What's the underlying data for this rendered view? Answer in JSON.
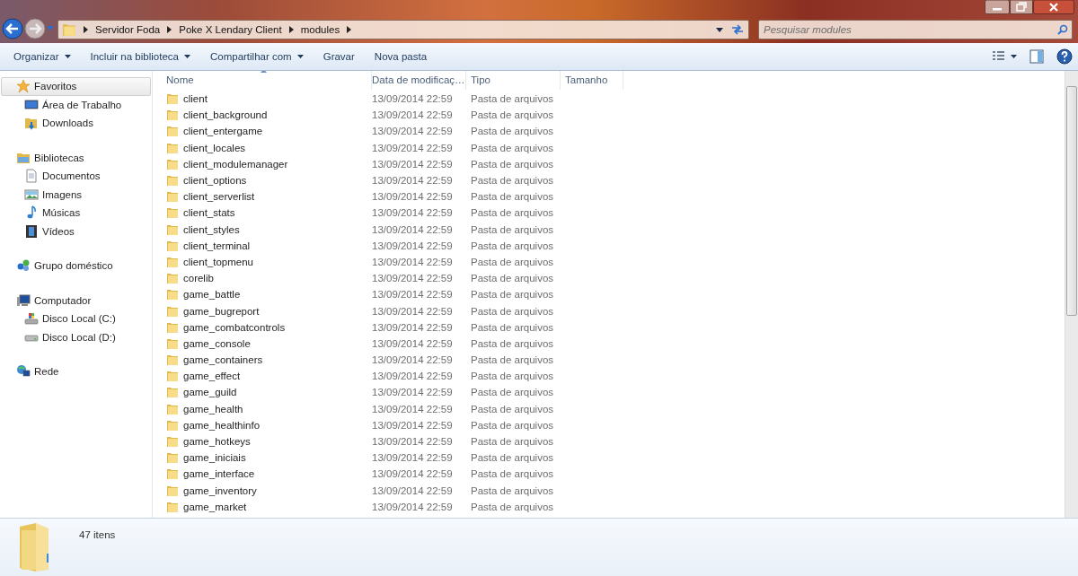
{
  "address_bar": {
    "breadcrumbs": [
      "Servidor Foda",
      "Poke X Lendary Client",
      "modules"
    ]
  },
  "search": {
    "placeholder": "Pesquisar modules"
  },
  "toolbar": {
    "buttons": [
      {
        "label": "Organizar",
        "dropdown": true
      },
      {
        "label": "Incluir na biblioteca",
        "dropdown": true
      },
      {
        "label": "Compartilhar com",
        "dropdown": true
      },
      {
        "label": "Gravar",
        "dropdown": false
      },
      {
        "label": "Nova pasta",
        "dropdown": false
      }
    ]
  },
  "sidebar": {
    "groups": [
      {
        "label": "Favoritos",
        "kind": "favorites",
        "selected": true,
        "children": [
          {
            "label": "Área de Trabalho",
            "kind": "desktop",
            "selected": false
          },
          {
            "label": "Downloads",
            "kind": "downloads",
            "selected": false
          }
        ]
      },
      {
        "label": "Bibliotecas",
        "kind": "libraries",
        "selected": false,
        "children": [
          {
            "label": "Documentos",
            "kind": "documents",
            "selected": false
          },
          {
            "label": "Imagens",
            "kind": "images",
            "selected": false
          },
          {
            "label": "Músicas",
            "kind": "music",
            "selected": false
          },
          {
            "label": "Vídeos",
            "kind": "videos",
            "selected": false
          }
        ]
      },
      {
        "label": "Grupo doméstico",
        "kind": "homegroup",
        "selected": false
      },
      {
        "label": "Computador",
        "kind": "computer",
        "selected": false,
        "children": [
          {
            "label": "Disco Local (C:)",
            "kind": "systemdrive",
            "selected": false
          },
          {
            "label": "Disco Local (D:)",
            "kind": "drive",
            "selected": false
          }
        ]
      },
      {
        "label": "Rede",
        "kind": "network",
        "selected": false
      }
    ]
  },
  "file_list": {
    "columns": [
      "Nome",
      "Data de modificaç…",
      "Tipo",
      "Tamanho"
    ],
    "rows": [
      {
        "name": "client",
        "modified": "13/09/2014 22:59",
        "type": "Pasta de arquivos"
      },
      {
        "name": "client_background",
        "modified": "13/09/2014 22:59",
        "type": "Pasta de arquivos"
      },
      {
        "name": "client_entergame",
        "modified": "13/09/2014 22:59",
        "type": "Pasta de arquivos"
      },
      {
        "name": "client_locales",
        "modified": "13/09/2014 22:59",
        "type": "Pasta de arquivos"
      },
      {
        "name": "client_modulemanager",
        "modified": "13/09/2014 22:59",
        "type": "Pasta de arquivos"
      },
      {
        "name": "client_options",
        "modified": "13/09/2014 22:59",
        "type": "Pasta de arquivos"
      },
      {
        "name": "client_serverlist",
        "modified": "13/09/2014 22:59",
        "type": "Pasta de arquivos"
      },
      {
        "name": "client_stats",
        "modified": "13/09/2014 22:59",
        "type": "Pasta de arquivos"
      },
      {
        "name": "client_styles",
        "modified": "13/09/2014 22:59",
        "type": "Pasta de arquivos"
      },
      {
        "name": "client_terminal",
        "modified": "13/09/2014 22:59",
        "type": "Pasta de arquivos"
      },
      {
        "name": "client_topmenu",
        "modified": "13/09/2014 22:59",
        "type": "Pasta de arquivos"
      },
      {
        "name": "corelib",
        "modified": "13/09/2014 22:59",
        "type": "Pasta de arquivos"
      },
      {
        "name": "game_battle",
        "modified": "13/09/2014 22:59",
        "type": "Pasta de arquivos"
      },
      {
        "name": "game_bugreport",
        "modified": "13/09/2014 22:59",
        "type": "Pasta de arquivos"
      },
      {
        "name": "game_combatcontrols",
        "modified": "13/09/2014 22:59",
        "type": "Pasta de arquivos"
      },
      {
        "name": "game_console",
        "modified": "13/09/2014 22:59",
        "type": "Pasta de arquivos"
      },
      {
        "name": "game_containers",
        "modified": "13/09/2014 22:59",
        "type": "Pasta de arquivos"
      },
      {
        "name": "game_effect",
        "modified": "13/09/2014 22:59",
        "type": "Pasta de arquivos"
      },
      {
        "name": "game_guild",
        "modified": "13/09/2014 22:59",
        "type": "Pasta de arquivos"
      },
      {
        "name": "game_health",
        "modified": "13/09/2014 22:59",
        "type": "Pasta de arquivos"
      },
      {
        "name": "game_healthinfo",
        "modified": "13/09/2014 22:59",
        "type": "Pasta de arquivos"
      },
      {
        "name": "game_hotkeys",
        "modified": "13/09/2014 22:59",
        "type": "Pasta de arquivos"
      },
      {
        "name": "game_iniciais",
        "modified": "13/09/2014 22:59",
        "type": "Pasta de arquivos"
      },
      {
        "name": "game_interface",
        "modified": "13/09/2014 22:59",
        "type": "Pasta de arquivos"
      },
      {
        "name": "game_inventory",
        "modified": "13/09/2014 22:59",
        "type": "Pasta de arquivos"
      },
      {
        "name": "game_market",
        "modified": "13/09/2014 22:59",
        "type": "Pasta de arquivos"
      }
    ]
  },
  "status_bar": {
    "count": "47 itens"
  }
}
